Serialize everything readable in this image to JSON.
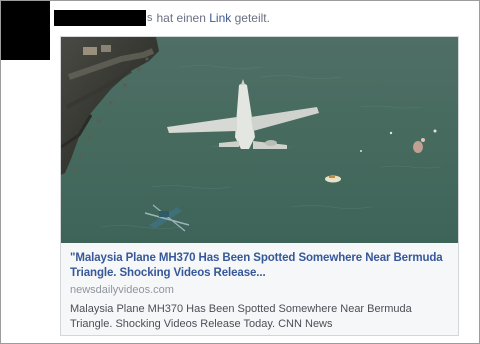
{
  "post": {
    "caret": "s",
    "action_text": "hat einen",
    "link_word": "Link",
    "suffix": "geteilt."
  },
  "link_card": {
    "title": "\"Malaysia Plane MH370 Has Been Spotted Somewhere Near Bermuda Triangle. Shocking Videos Release...",
    "domain": "newsdailyvideos.com",
    "description": "Malaysia Plane MH370 Has Been Spotted Somewhere Near Bermuda Triangle. Shocking Videos Release Today. CNN News"
  },
  "colors": {
    "link_blue": "#3b5998",
    "title_blue": "#365899",
    "muted_gray": "#90949c",
    "text_gray": "#4b4f56",
    "water": "#496c60"
  }
}
